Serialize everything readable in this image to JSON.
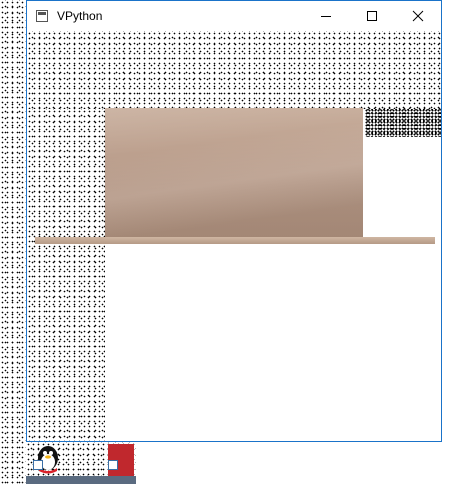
{
  "window": {
    "title": "VPython",
    "controls": {
      "minimize_icon": "minimize-icon",
      "maximize_icon": "maximize-icon",
      "close_icon": "close-icon"
    },
    "border_color": "#1a73c9"
  },
  "scene": {
    "box_color": "#bea290",
    "floor_color": "#c2a893"
  }
}
